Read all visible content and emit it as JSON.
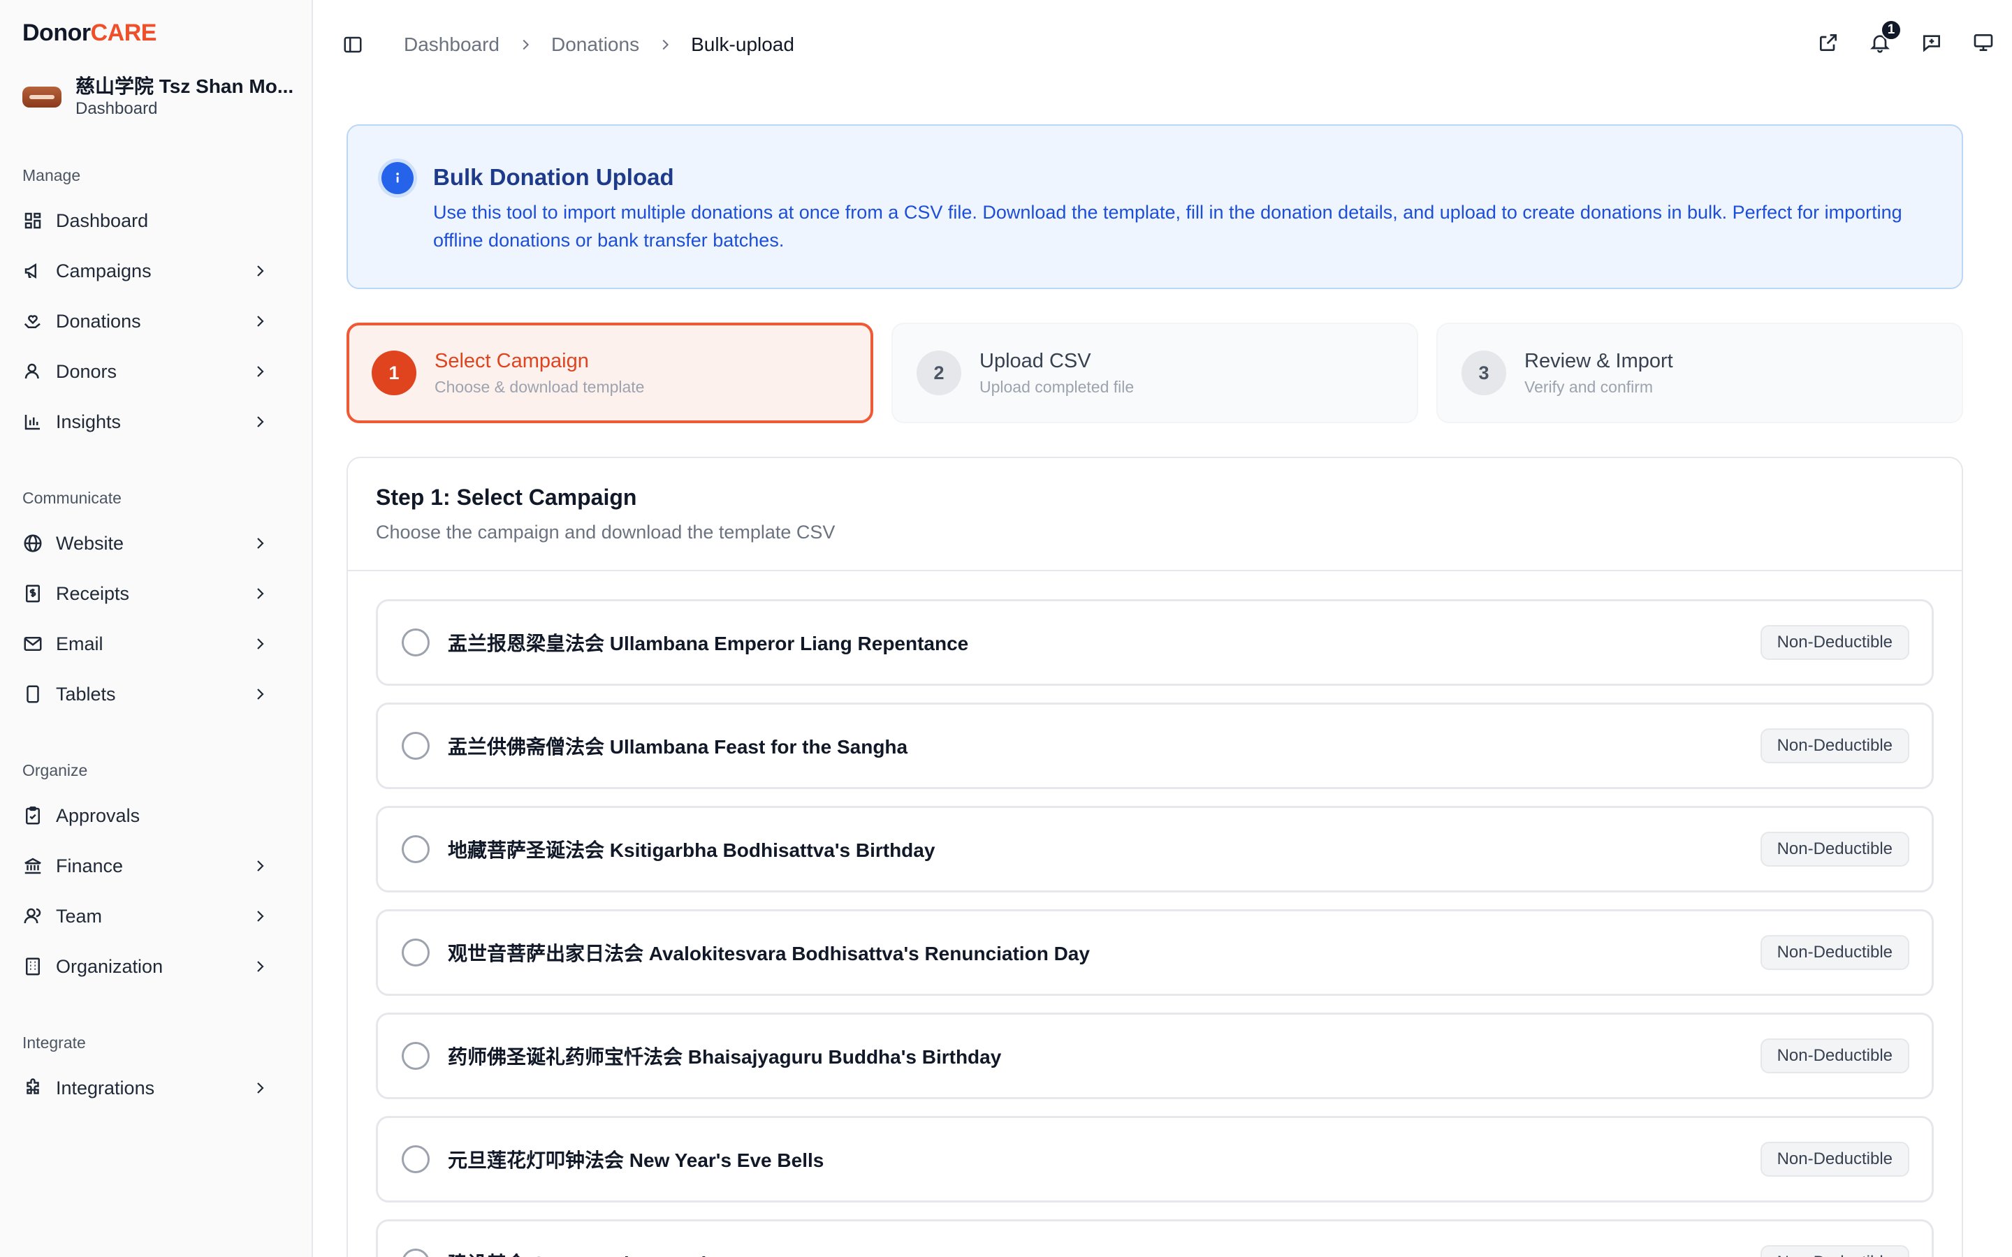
{
  "brand": {
    "part1": "Donor",
    "part2": "CARE"
  },
  "org": {
    "name": "慈山学院 Tsz Shan Mo...",
    "subtitle": "Dashboard"
  },
  "sidebar": {
    "sections": [
      {
        "title": "Manage",
        "items": [
          {
            "label": "Dashboard",
            "icon": "grid-icon",
            "chevron": false
          },
          {
            "label": "Campaigns",
            "icon": "megaphone-icon",
            "chevron": true
          },
          {
            "label": "Donations",
            "icon": "hand-heart-icon",
            "chevron": true
          },
          {
            "label": "Donors",
            "icon": "user-icon",
            "chevron": true
          },
          {
            "label": "Insights",
            "icon": "bar-chart-icon",
            "chevron": true
          }
        ]
      },
      {
        "title": "Communicate",
        "items": [
          {
            "label": "Website",
            "icon": "globe-icon",
            "chevron": true
          },
          {
            "label": "Receipts",
            "icon": "receipt-icon",
            "chevron": true
          },
          {
            "label": "Email",
            "icon": "mail-icon",
            "chevron": true
          },
          {
            "label": "Tablets",
            "icon": "tablet-icon",
            "chevron": true
          }
        ]
      },
      {
        "title": "Organize",
        "items": [
          {
            "label": "Approvals",
            "icon": "clipboard-check-icon",
            "chevron": false
          },
          {
            "label": "Finance",
            "icon": "bank-icon",
            "chevron": true
          },
          {
            "label": "Team",
            "icon": "team-icon",
            "chevron": true
          },
          {
            "label": "Organization",
            "icon": "building-icon",
            "chevron": true
          }
        ]
      },
      {
        "title": "Integrate",
        "items": [
          {
            "label": "Integrations",
            "icon": "puzzle-icon",
            "chevron": true
          }
        ]
      }
    ]
  },
  "breadcrumb": [
    "Dashboard",
    "Donations",
    "Bulk-upload"
  ],
  "topbar": {
    "notification_count": "1"
  },
  "info": {
    "title": "Bulk Donation Upload",
    "body": "Use this tool to import multiple donations at once from a CSV file. Download the template, fill in the donation details, and upload to create donations in bulk. Perfect for importing offline donations or bank transfer batches."
  },
  "steps": [
    {
      "num": "1",
      "title": "Select Campaign",
      "sub": "Choose & download template",
      "active": true
    },
    {
      "num": "2",
      "title": "Upload CSV",
      "sub": "Upload completed file",
      "active": false
    },
    {
      "num": "3",
      "title": "Review & Import",
      "sub": "Verify and confirm",
      "active": false
    }
  ],
  "card": {
    "title": "Step 1: Select Campaign",
    "subtitle": "Choose the campaign and download the template CSV"
  },
  "campaigns": [
    {
      "name": "盂兰报恩梁皇法会 Ullambana Emperor Liang Repentance",
      "badge": "Non-Deductible"
    },
    {
      "name": "盂兰供佛斋僧法会 Ullambana Feast for the Sangha",
      "badge": "Non-Deductible"
    },
    {
      "name": "地藏菩萨圣诞法会 Ksitigarbha Bodhisattva's Birthday",
      "badge": "Non-Deductible"
    },
    {
      "name": "观世音菩萨出家日法会 Avalokitesvara Bodhisattva's Renunciation Day",
      "badge": "Non-Deductible"
    },
    {
      "name": "药师佛圣诞礼药师宝忏法会 Bhaisajyaguru Buddha's Birthday",
      "badge": "Non-Deductible"
    },
    {
      "name": "元旦莲花灯叩钟法会 New Year's Eve Bells",
      "badge": "Non-Deductible"
    },
    {
      "name": "建设基金 Construction Fund",
      "badge": "Non-Deductible"
    }
  ],
  "colors": {
    "accent": "#e0441f",
    "info_bg": "#eef5ff",
    "info_text": "#1d4ed8"
  }
}
